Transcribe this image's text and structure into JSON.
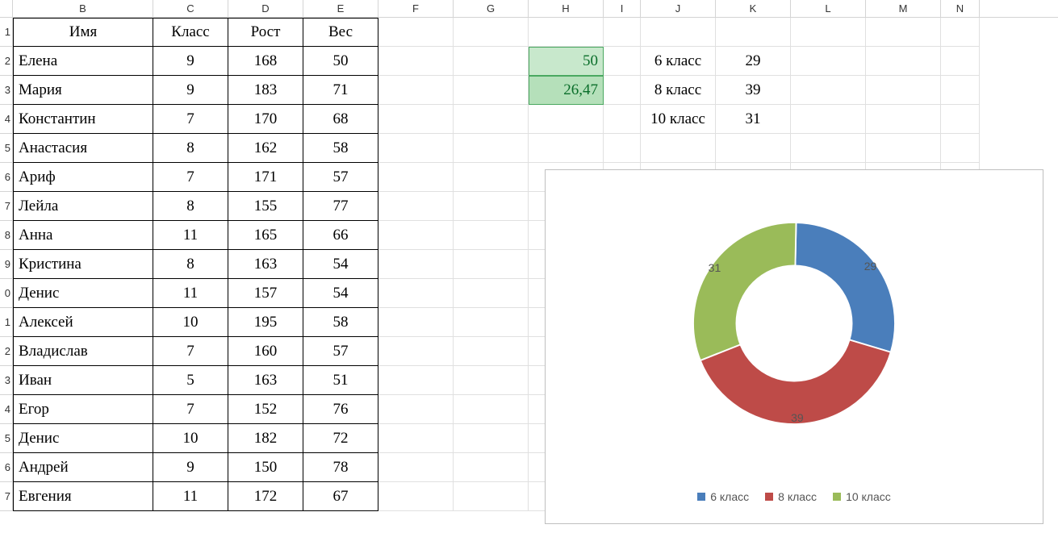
{
  "columns": [
    {
      "letter": "B",
      "width": 174
    },
    {
      "letter": "C",
      "width": 93
    },
    {
      "letter": "D",
      "width": 93
    },
    {
      "letter": "E",
      "width": 93
    },
    {
      "letter": "F",
      "width": 93
    },
    {
      "letter": "G",
      "width": 93
    },
    {
      "letter": "H",
      "width": 93
    },
    {
      "letter": "I",
      "width": 46
    },
    {
      "letter": "J",
      "width": 93
    },
    {
      "letter": "K",
      "width": 93
    },
    {
      "letter": "L",
      "width": 93
    },
    {
      "letter": "M",
      "width": 93
    },
    {
      "letter": "N",
      "width": 48
    }
  ],
  "row_numbers": [
    "1",
    "2",
    "3",
    "4",
    "5",
    "6",
    "7",
    "8",
    "9",
    "0",
    "1",
    "2",
    "3",
    "4",
    "5",
    "6",
    "7"
  ],
  "table": {
    "headers": {
      "name": "Имя",
      "klass": "Класс",
      "height": "Рост",
      "weight": "Вес"
    },
    "rows": [
      {
        "name": "Елена",
        "klass": "9",
        "height": "168",
        "weight": "50"
      },
      {
        "name": "Мария",
        "klass": "9",
        "height": "183",
        "weight": "71"
      },
      {
        "name": "Константин",
        "klass": "7",
        "height": "170",
        "weight": "68"
      },
      {
        "name": "Анастасия",
        "klass": "8",
        "height": "162",
        "weight": "58"
      },
      {
        "name": "Ариф",
        "klass": "7",
        "height": "171",
        "weight": "57"
      },
      {
        "name": "Лейла",
        "klass": "8",
        "height": "155",
        "weight": "77"
      },
      {
        "name": "Анна",
        "klass": "11",
        "height": "165",
        "weight": "66"
      },
      {
        "name": "Кристина",
        "klass": "8",
        "height": "163",
        "weight": "54"
      },
      {
        "name": "Денис",
        "klass": "11",
        "height": "157",
        "weight": "54"
      },
      {
        "name": "Алексей",
        "klass": "10",
        "height": "195",
        "weight": "58"
      },
      {
        "name": "Владислав",
        "klass": "7",
        "height": "160",
        "weight": "57"
      },
      {
        "name": "Иван",
        "klass": "5",
        "height": "163",
        "weight": "51"
      },
      {
        "name": "Егор",
        "klass": "7",
        "height": "152",
        "weight": "76"
      },
      {
        "name": "Денис",
        "klass": "10",
        "height": "182",
        "weight": "72"
      },
      {
        "name": "Андрей",
        "klass": "9",
        "height": "150",
        "weight": "78"
      },
      {
        "name": "Евгения",
        "klass": "11",
        "height": "172",
        "weight": "67"
      }
    ]
  },
  "highlight": {
    "h2": "50",
    "h3": "26,47"
  },
  "summary": [
    {
      "label": "6 класс",
      "value": "29"
    },
    {
      "label": "8 класс",
      "value": "39"
    },
    {
      "label": "10 класс",
      "value": "31"
    }
  ],
  "chart_data": {
    "type": "pie",
    "categories": [
      "6 класс",
      "8 класс",
      "10 класс"
    ],
    "values": [
      29,
      39,
      31
    ],
    "colors": [
      "#4a7ebb",
      "#be4b48",
      "#9abb59"
    ],
    "title": "",
    "legend_position": "bottom",
    "donut": true
  }
}
